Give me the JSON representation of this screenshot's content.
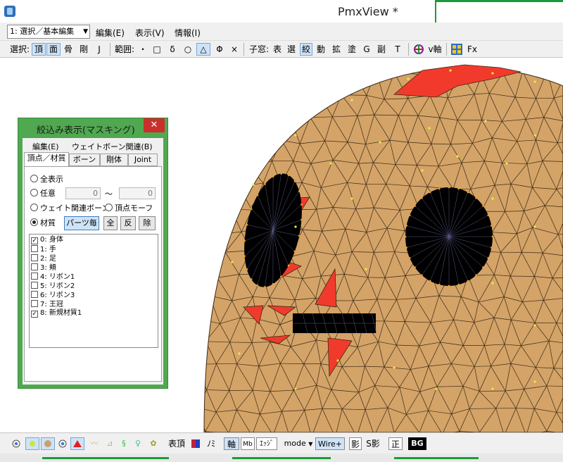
{
  "window": {
    "title": "PmxView *"
  },
  "menubar": {
    "mode_select": "1: 選択／基本編集",
    "items": [
      "編集(E)",
      "表示(V)",
      "情報(I)"
    ]
  },
  "toolbar": {
    "select_label": "選択:",
    "select_items": [
      "頂",
      "面",
      "骨",
      "剛",
      "J"
    ],
    "range_label": "範囲:",
    "range_items": [
      "・",
      "□",
      "δ",
      "○",
      "△",
      "Φ",
      "×"
    ],
    "child_label": "子窓:",
    "child_items": [
      "表",
      "選",
      "絞",
      "動",
      "拡",
      "塗",
      "G",
      "副",
      "T"
    ],
    "v_axis": "v軸",
    "fx": "Fx"
  },
  "dialog": {
    "title": "絞込み表示(マスキング)",
    "close": "✕",
    "menu": [
      "編集(E)",
      "ウェイトボーン関連(B)"
    ],
    "tabs": [
      "頂点／材質",
      "ボーン",
      "剛体",
      "Joint"
    ],
    "radio_all": "全表示",
    "radio_any": "任意",
    "range_from": "0",
    "range_tilde": "〜",
    "range_to": "0",
    "radio_weight": "ウェイト関連ボーン",
    "radio_morph": "頂点モーフ",
    "radio_material": "材質",
    "btn_parts": "パーツ毎",
    "btn_all": "全",
    "btn_invert": "反",
    "btn_remove": "除",
    "materials": [
      {
        "label": "0: 身体",
        "checked": true
      },
      {
        "label": "1: 手",
        "checked": false
      },
      {
        "label": "2: 足",
        "checked": false
      },
      {
        "label": "3: 頬",
        "checked": false
      },
      {
        "label": "4: リボン1",
        "checked": false
      },
      {
        "label": "5: リボン2",
        "checked": false
      },
      {
        "label": "6: リボン3",
        "checked": false
      },
      {
        "label": "7: 王冠",
        "checked": false
      },
      {
        "label": "8: 新規材質1",
        "checked": true
      }
    ]
  },
  "bottombar": {
    "table_top": "表頂",
    "no": "ﾉﾐ",
    "axis": "軸",
    "mb": "Mb",
    "edge": "ｴｯｼﾞ",
    "mode": "mode",
    "wire": "Wire+",
    "shadow": "影",
    "s_shadow": "S影",
    "ortho": "正",
    "bg": "BG"
  },
  "colors": {
    "skin": "#d4a368",
    "red": "#f23a2c",
    "wire": "#3a2a14",
    "vertex": "#e8f040",
    "arrow": "#1a3fcf"
  }
}
